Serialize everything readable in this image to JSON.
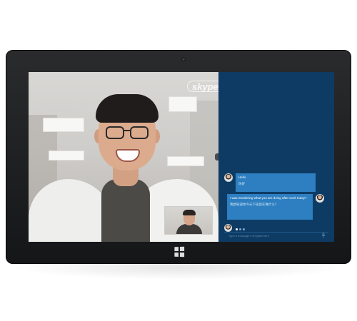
{
  "video_call": {
    "logo_text": "skype"
  },
  "chat": {
    "messages": [
      {
        "text": "Hello",
        "translation": "你好"
      },
      {
        "text": "I was wondering what you are doing after work today?",
        "translation": "我想知道你今天下班后在做什么？"
      }
    ],
    "input_placeholder": "Type a message in English here"
  },
  "colors": {
    "chat_panel": "#0e3b63",
    "message_bubble": "#2d7fc1",
    "tablet_bezel": "#1c1d1f"
  }
}
